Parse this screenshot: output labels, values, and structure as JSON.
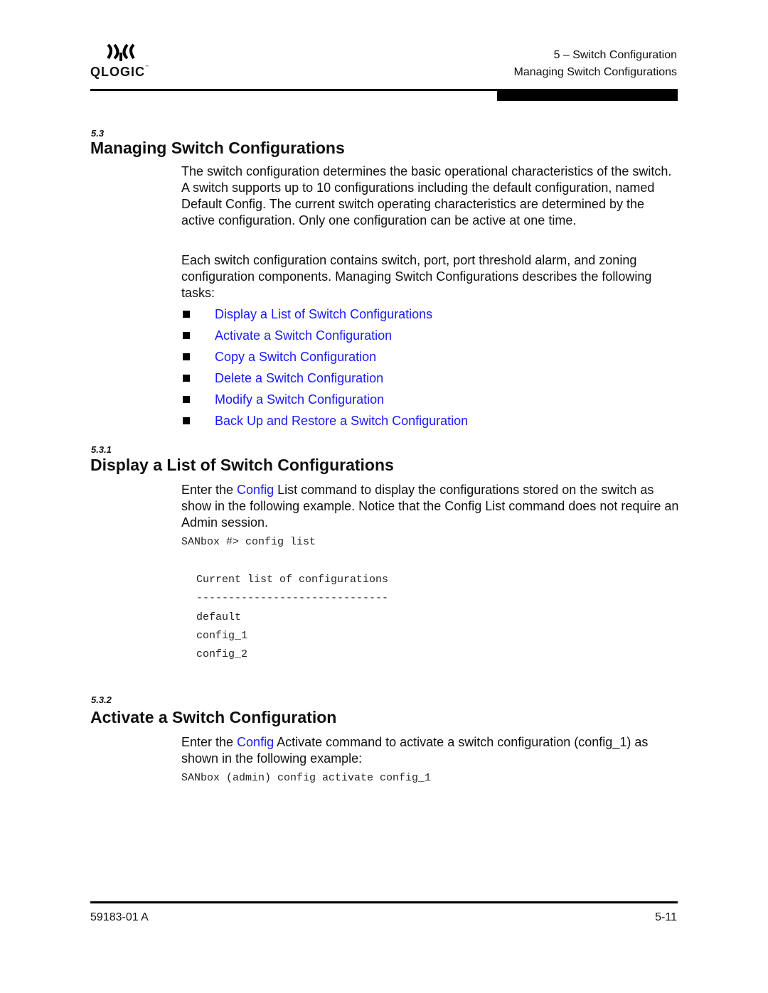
{
  "header": {
    "logo_text": "QLOGIC",
    "logo_tm": "™",
    "chapter": "5 – Switch Configuration",
    "section": "Managing Switch Configurations"
  },
  "section_5_3": {
    "number": "5.3",
    "title": "Managing Switch Configurations",
    "para1": "The switch configuration determines the basic operational characteristics of the switch. A switch supports up to 10 configurations including the default configuration, named Default Config. The current switch operating characteristics are determined by the active configuration. Only one configuration can be active at one time.",
    "para2": "Each switch configuration contains switch, port, port threshold alarm, and zoning configuration components. Managing Switch Configurations describes the following tasks:",
    "tasks": [
      "Display a List of Switch Configurations",
      "Activate a Switch Configuration",
      "Copy a Switch Configuration",
      "Delete a Switch Configuration",
      "Modify a Switch Configuration",
      "Back Up and Restore a Switch Configuration"
    ]
  },
  "section_5_3_1": {
    "number": "5.3.1",
    "title": "Display a List of Switch Configurations",
    "para_prefix": "Enter the ",
    "para_link": "Config",
    "para_suffix": " List command to display the configurations stored on the switch as show in the following example. Notice that the Config List command does not require an Admin session.",
    "code_command": "SANbox #> config list",
    "code_output": [
      "Current list of configurations",
      "------------------------------",
      "default",
      "config_1",
      "config_2"
    ]
  },
  "section_5_3_2": {
    "number": "5.3.2",
    "title": "Activate a Switch Configuration",
    "para_prefix": "Enter the ",
    "para_link": "Config",
    "para_suffix": " Activate command to activate a switch configuration (config_1) as shown in the following example:",
    "code_command": "SANbox (admin) config activate config_1"
  },
  "footer": {
    "doc_number": "59183-01 A",
    "page_number": "5-11"
  }
}
